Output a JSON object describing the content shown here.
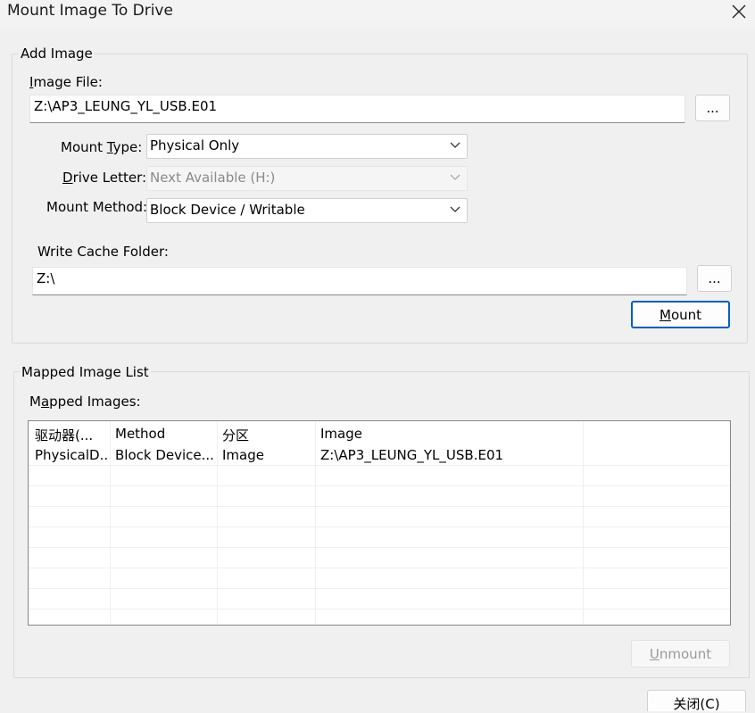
{
  "window": {
    "title": "Mount Image To Drive",
    "close_icon": "close-icon"
  },
  "add_image": {
    "legend": "Add Image",
    "image_file_label_u": "I",
    "image_file_label_rest": "mage File:",
    "image_file_value": "Z:\\AP3_LEUNG_YL_USB.E01",
    "browse_label": "...",
    "mount_type_label_pre": "Mount ",
    "mount_type_label_u": "T",
    "mount_type_label_rest": "ype:",
    "mount_type_value": "Physical Only",
    "drive_letter_label_u": "D",
    "drive_letter_label_rest": "rive Letter:",
    "drive_letter_value": "Next Available (H:)",
    "mount_method_label": "Mount Method:",
    "mount_method_value": "Block Device / Writable",
    "write_cache_label": "Write Cache Folder:",
    "write_cache_value": "Z:\\",
    "cache_browse_label": "...",
    "mount_button_u": "M",
    "mount_button_rest": "ount"
  },
  "mapped": {
    "legend": "Mapped Image List",
    "images_label_pre": "M",
    "images_label_u": "a",
    "images_label_rest": "pped Images:",
    "columns": [
      "驱动器(...",
      "Method",
      "分区",
      "Image"
    ],
    "rows": [
      [
        "PhysicalD...",
        "Block Device...",
        "Image",
        "Z:\\AP3_LEUNG_YL_USB.E01"
      ]
    ],
    "unmount_u": "U",
    "unmount_rest": "nmount"
  },
  "close_button": "关闭(C)",
  "colors": {
    "accent": "#005fb8",
    "background": "#f0f0f0"
  }
}
